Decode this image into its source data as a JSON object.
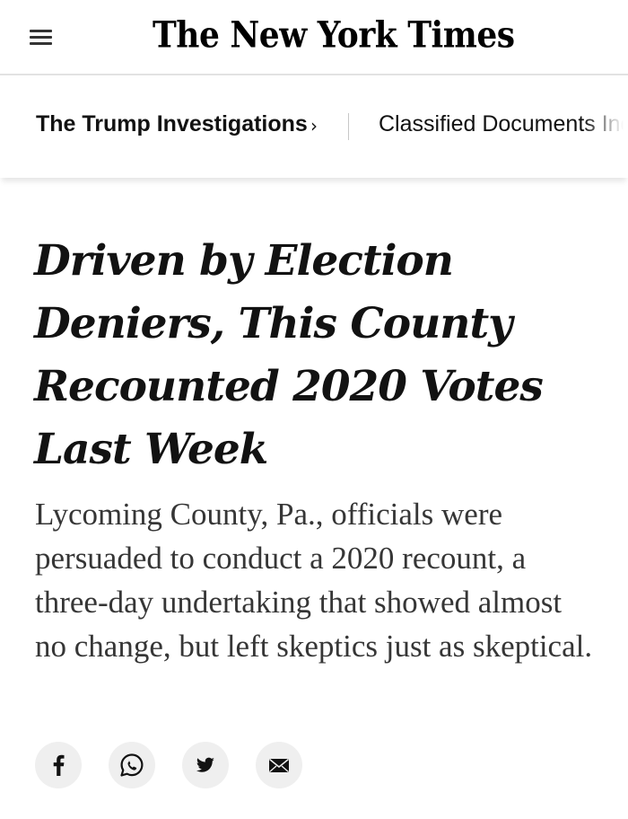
{
  "masthead": {
    "menu_icon": "hamburger-menu-icon",
    "logo_text": "The New York Times"
  },
  "section_nav": {
    "primary": "The Trump Investigations",
    "chevron": "›",
    "secondary": "Classified Documents Inq"
  },
  "article": {
    "headline": "Driven by Election Deniers, This County Recounted 2020 Votes Last Week",
    "summary": "Lycoming County, Pa., officials were persuaded to conduct a 2020 recount, a three-day undertaking that showed almost no change, but left skeptics just as skeptical."
  },
  "share": {
    "buttons": [
      {
        "icon": "facebook-icon"
      },
      {
        "icon": "whatsapp-icon"
      },
      {
        "icon": "twitter-icon"
      },
      {
        "icon": "email-icon"
      }
    ]
  },
  "colors": {
    "text": "#121212",
    "summary_text": "#363636",
    "share_bg": "#efefef",
    "divider": "#e2e2e2"
  }
}
